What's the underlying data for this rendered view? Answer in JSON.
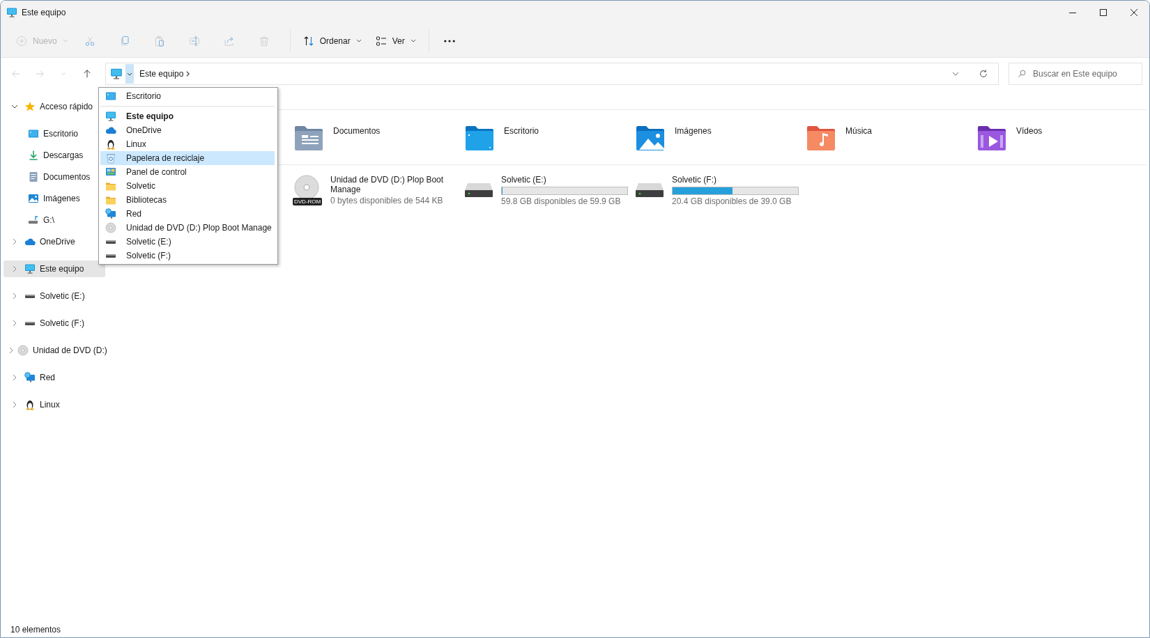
{
  "window": {
    "title": "Este equipo"
  },
  "toolbar": [
    {
      "kind": "new",
      "label": "Nuevo",
      "disabled": true
    },
    {
      "kind": "cut",
      "disabled": true
    },
    {
      "kind": "copy",
      "disabled": true
    },
    {
      "kind": "paste",
      "disabled": true
    },
    {
      "kind": "rename",
      "disabled": true
    },
    {
      "kind": "share",
      "disabled": true
    },
    {
      "kind": "delete",
      "disabled": true
    },
    {
      "kind": "separator"
    },
    {
      "kind": "sort",
      "label": "Ordenar",
      "disabled": false
    },
    {
      "kind": "view",
      "label": "Ver",
      "disabled": false
    },
    {
      "kind": "separator"
    },
    {
      "kind": "more",
      "disabled": false
    }
  ],
  "navigation": [
    {
      "kind": "back",
      "disabled": true
    },
    {
      "kind": "forward",
      "disabled": true
    },
    {
      "kind": "recent",
      "disabled": true
    },
    {
      "kind": "up",
      "disabled": false
    }
  ],
  "address": {
    "dropdown_open": true,
    "path": [
      "Este equipo"
    ]
  },
  "search": {
    "placeholder": "Buscar en Este equipo"
  },
  "sidebar": {
    "items": [
      {
        "label": "Acceso rápido",
        "kind": "star",
        "expanded": true,
        "selected": false,
        "children": [
          {
            "label": "Escritorio",
            "kind": "desktop",
            "selected": false
          },
          {
            "label": "Descargas",
            "kind": "download",
            "selected": false
          },
          {
            "label": "Documentos",
            "kind": "document",
            "selected": false
          },
          {
            "label": "Imágenes",
            "kind": "picture",
            "selected": false
          },
          {
            "label": "G:\\",
            "kind": "netdrive",
            "selected": false
          }
        ]
      },
      {
        "label": "OneDrive",
        "kind": "cloud",
        "expanded": false,
        "selected": false
      },
      {
        "label": "Este equipo",
        "kind": "monitor",
        "expanded": false,
        "selected": true
      },
      {
        "label": "Solvetic (E:)",
        "kind": "drive",
        "expanded": false,
        "selected": false
      },
      {
        "label": "Solvetic (F:)",
        "kind": "drive",
        "expanded": false,
        "selected": false
      },
      {
        "label": "Unidad de DVD (D:)",
        "kind": "dvd",
        "expanded": false,
        "selected": false
      },
      {
        "label": "Red",
        "kind": "network",
        "expanded": false,
        "selected": false
      },
      {
        "label": "Linux",
        "kind": "linux",
        "expanded": false,
        "selected": false
      }
    ]
  },
  "address_menu": {
    "items": [
      {
        "label": "Escritorio",
        "kind": "desktop",
        "current": false,
        "selected": false
      },
      {
        "kind": "separator"
      },
      {
        "label": "Este equipo",
        "kind": "monitor",
        "current": true,
        "selected": false
      },
      {
        "label": "OneDrive",
        "kind": "cloud",
        "current": false,
        "selected": false
      },
      {
        "label": "Linux",
        "kind": "linux",
        "current": false,
        "selected": false
      },
      {
        "label": "Papelera de reciclaje",
        "kind": "recycle",
        "current": false,
        "selected": true
      },
      {
        "label": "Panel de control",
        "kind": "control",
        "current": false,
        "selected": false
      },
      {
        "label": "Solvetic",
        "kind": "folder",
        "current": false,
        "selected": false
      },
      {
        "label": "Bibliotecas",
        "kind": "folder",
        "current": false,
        "selected": false
      },
      {
        "label": "Red",
        "kind": "network",
        "current": false,
        "selected": false
      },
      {
        "label": "Unidad de DVD (D:) Plop Boot Manage",
        "kind": "dvd",
        "current": false,
        "selected": false
      },
      {
        "label": "Solvetic (E:)",
        "kind": "drive",
        "current": false,
        "selected": false
      },
      {
        "label": "Solvetic (F:)",
        "kind": "drive",
        "current": false,
        "selected": false
      }
    ]
  },
  "folders": [
    {
      "label": "Documentos",
      "kind": "documents"
    },
    {
      "label": "Escritorio",
      "kind": "desktop"
    },
    {
      "label": "Imágenes",
      "kind": "pictures"
    },
    {
      "label": "Música",
      "kind": "music"
    },
    {
      "label": "Vídeos",
      "kind": "videos"
    }
  ],
  "drives": [
    {
      "kind": "dvd",
      "label": "Unidad de DVD (D:) Plop Boot Manage",
      "badge": "DVD-ROM",
      "free": "0 bytes disponibles de 544 KB"
    },
    {
      "kind": "disk",
      "label": "Solvetic (E:)",
      "level": 0.002,
      "free": "59.8 GB disponibles de 59.9 GB"
    },
    {
      "kind": "disk",
      "label": "Solvetic (F:)",
      "level": 0.477,
      "free": "20.4 GB disponibles de 39.0 GB"
    }
  ],
  "status_bar": {
    "text": "10 elementos"
  }
}
